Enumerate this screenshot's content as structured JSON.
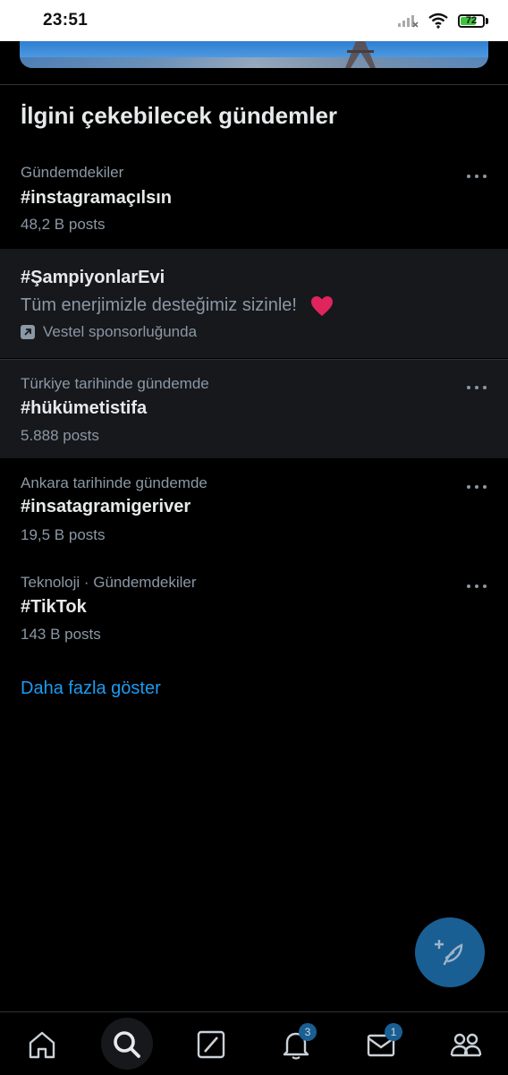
{
  "status_bar": {
    "time": "23:51",
    "battery": "72",
    "battery_level": 0.72,
    "battery_color": "#3ec33e"
  },
  "section": {
    "title": "İlgini çekebilecek gündemler"
  },
  "trends": [
    {
      "meta": "Gündemdekiler",
      "name": "#instagramaçılsın",
      "count": "48,2 B posts"
    },
    {
      "meta": "Türkiye tarihinde gündemde",
      "name": "#hükümetistifa",
      "count": "5.888 posts"
    },
    {
      "meta": "Ankara tarihinde gündemde",
      "name": "#insatagramigeriver",
      "count": "19,5 B posts"
    },
    {
      "meta": "Teknoloji · Gündemdekiler",
      "name": "#TikTok",
      "count": "143 B posts"
    }
  ],
  "promoted": {
    "name": "#ŞampiyonlarEvi",
    "text": "Tüm enerjimizle desteğimiz sizinle!",
    "label": "Vestel sponsorluğunda",
    "heart_color": "#e0245e"
  },
  "show_more": "Daha fazla göster",
  "bottom_nav": {
    "items": [
      "home-icon",
      "search-icon",
      "grok-icon",
      "bell-icon",
      "mail-icon",
      "people-icon"
    ],
    "notifications_badge": "3",
    "messages_badge": "1"
  },
  "colors": {
    "accent": "#1d9bf0",
    "fab": "#1a5f93",
    "background": "#000000",
    "highlight": "#16181c"
  }
}
